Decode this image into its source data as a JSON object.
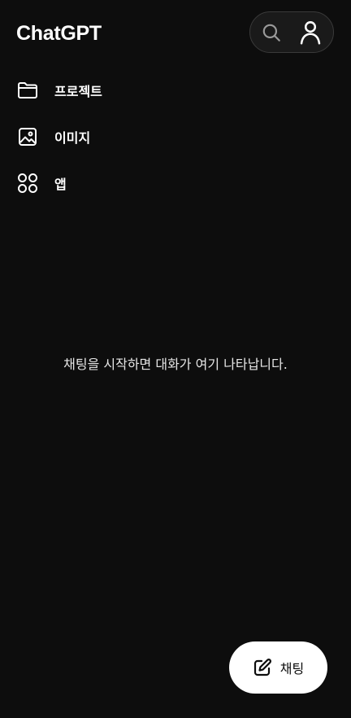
{
  "header": {
    "title": "ChatGPT",
    "search_icon": "search-icon",
    "profile_icon": "user-icon"
  },
  "nav": {
    "items": [
      {
        "label": "프로젝트",
        "icon": "folder-icon"
      },
      {
        "label": "이미지",
        "icon": "image-icon"
      },
      {
        "label": "앱",
        "icon": "apps-grid-icon"
      }
    ]
  },
  "main": {
    "empty_message": "채팅을 시작하면 대화가 여기 나타납니다."
  },
  "fab": {
    "label": "채팅",
    "icon": "edit-icon"
  },
  "colors": {
    "background": "#0d0d0d",
    "text": "#ffffff",
    "muted_text": "#e6e6e6",
    "pill_border": "#3a3a3a",
    "fab_background": "#ffffff"
  }
}
